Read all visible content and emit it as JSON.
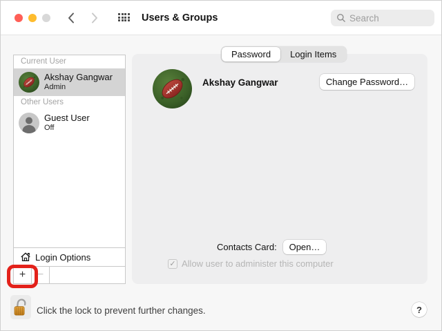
{
  "window": {
    "title": "Users & Groups",
    "search_placeholder": "Search"
  },
  "tabs": [
    {
      "label": "Password",
      "selected": true
    },
    {
      "label": "Login Items",
      "selected": false
    }
  ],
  "sidebar": {
    "current_user_header": "Current User",
    "current_user": {
      "name": "Akshay Gangwar",
      "role": "Admin"
    },
    "other_users_header": "Other Users",
    "other_users": [
      {
        "name": "Guest User",
        "status": "Off"
      }
    ],
    "login_options_label": "Login Options",
    "add_button_label": "+",
    "remove_button_label": "−"
  },
  "main": {
    "user_name": "Akshay Gangwar",
    "change_password_label": "Change Password…",
    "contacts_card_label": "Contacts Card:",
    "open_button_label": "Open…",
    "admin_checkbox_label": "Allow user to administer this computer",
    "admin_checkbox_checked": true
  },
  "footer": {
    "lock_text": "Click the lock to prevent further changes.",
    "help_label": "?"
  },
  "icons": {
    "checkmark": "✓",
    "names": [
      "back-chevron-icon",
      "forward-chevron-icon",
      "show-all-grid-icon",
      "search-icon",
      "football-avatar",
      "guest-avatar",
      "home-icon",
      "unlocked-lock-icon",
      "help-icon"
    ]
  },
  "colors": {
    "annotation_red": "#e3211a",
    "selected_row_bg": "#d4d4d4",
    "traffic_red": "#ff5f57",
    "traffic_yellow": "#febc2e",
    "traffic_disabled_gray": "#d8d8d8",
    "panel_bg": "#eeeeef",
    "lock_body_orange": "#d8942c"
  }
}
